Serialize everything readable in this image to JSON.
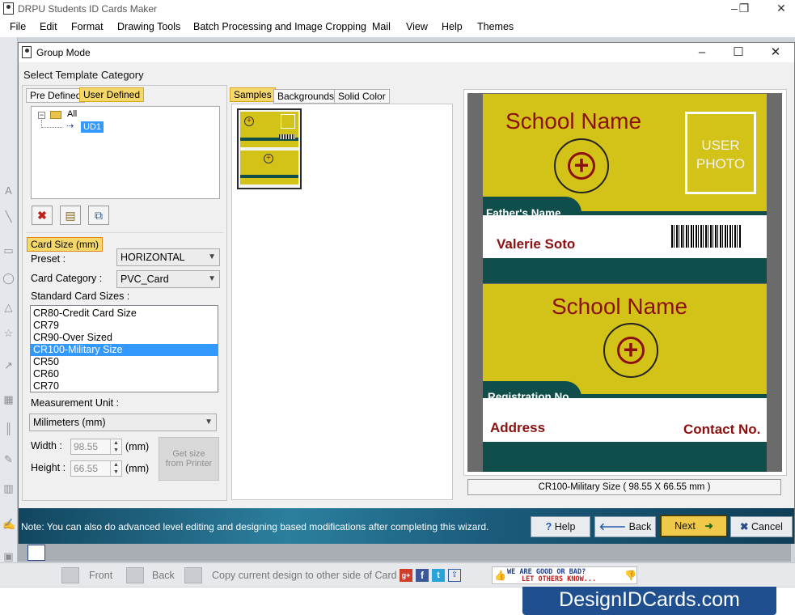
{
  "app": {
    "title": "DRPU Students ID Cards Maker",
    "menu": [
      "File",
      "Edit",
      "Format",
      "Drawing Tools",
      "Batch Processing and Image Cropping",
      "Mail",
      "View",
      "Help",
      "Themes"
    ]
  },
  "dialog": {
    "title": "Group Mode",
    "section_title": "Select Template Category",
    "category_tabs": [
      "Pre Defined",
      "User Defined"
    ],
    "tree": {
      "root": "All",
      "child": "UD1"
    },
    "card_size": {
      "label": "Card Size (mm)",
      "preset_label": "Preset :",
      "preset_value": "HORIZONTAL",
      "category_label": "Card Category :",
      "category_value": "PVC_Card",
      "standard_label": "Standard Card Sizes :",
      "sizes": [
        "CR80-Credit Card Size",
        "CR79",
        "CR90-Over Sized",
        "CR100-Military Size",
        "CR50",
        "CR60",
        "CR70"
      ],
      "selected_index": 3,
      "measurement_label": "Measurement Unit :",
      "measurement_value": "Milimeters (mm)",
      "width_label": "Width :",
      "width_value": "98.55",
      "width_unit": "(mm)",
      "height_label": "Height :",
      "height_value": "66.55",
      "height_unit": "(mm)",
      "printer_button": "Get size from Printer"
    },
    "sample_tabs": [
      "Samples",
      "Backgrounds",
      "Solid Color"
    ],
    "preview": {
      "front": {
        "school_name": "School Name",
        "photo_text": "USER PHOTO",
        "fathers_name": "Father's Name",
        "student_name": "Valerie Soto"
      },
      "back": {
        "school_name": "School Name",
        "registration": "Registration No",
        "address": "Address",
        "contact": "Contact No."
      },
      "size_caption": "CR100-Military Size ( 98.55 X 66.55 mm )"
    },
    "note": "Note: You can also do advanced level editing and designing based modifications after completing this wizard.",
    "buttons": {
      "help": "Help",
      "back": "Back",
      "next": "Next",
      "cancel": "Cancel"
    }
  },
  "statusbar": {
    "front": "Front",
    "back": "Back",
    "copy": "Copy current design to other side of Card",
    "feedback_line1": "WE ARE GOOD OR BAD?",
    "feedback_line2": "LET OTHERS KNOW..."
  },
  "brand": "DesignIDCards.com",
  "colors": {
    "card_yellow": "#d3c319",
    "card_teal": "#0f4e4a",
    "card_red_text": "#8b1010",
    "highlight_tab": "#f5d76a"
  }
}
